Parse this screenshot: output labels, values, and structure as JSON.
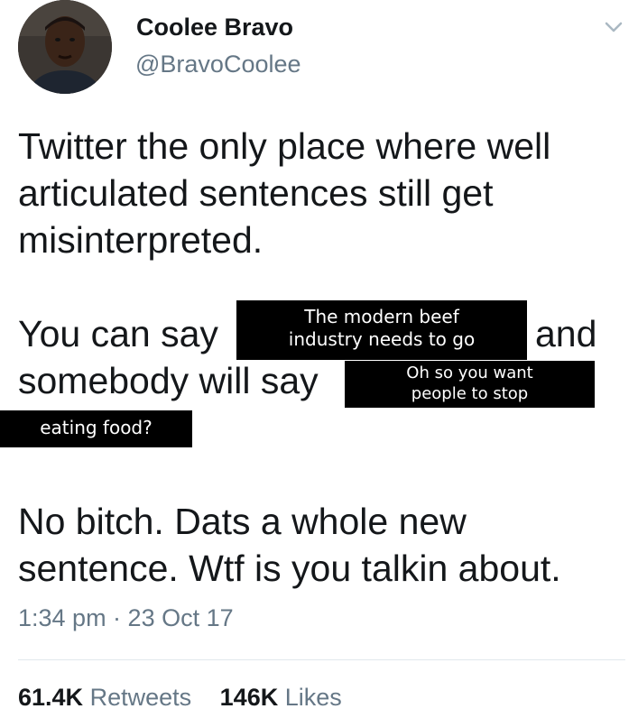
{
  "author": {
    "display_name": "Coolee Bravo",
    "handle": "@BravoCoolee",
    "avatar_icon": "profile-photo"
  },
  "tweet": {
    "paragraph1_line1": "Twitter the only place where well",
    "paragraph1_line2": "articulated sentences still get",
    "paragraph1_line3": "misinterpreted.",
    "paragraph2_you_can_say": "You can say",
    "paragraph2_and": "and",
    "paragraph2_somebody_will_say": "somebody will say",
    "paragraph3_line1": "No bitch. Dats a whole new",
    "paragraph3_line2": "sentence. Wtf is you talkin about."
  },
  "overlays": {
    "box1_line1": "The modern beef",
    "box1_line2": "industry needs to go",
    "box2_line1": "Oh so you want",
    "box2_line2": "people to stop",
    "box3": "eating food?"
  },
  "timestamp": "1:34 pm · 23 Oct 17",
  "stats": {
    "retweets_count": "61.4K",
    "retweets_label": "Retweets",
    "likes_count": "146K",
    "likes_label": "Likes"
  },
  "colors": {
    "text_primary": "#14171a",
    "text_secondary": "#657786",
    "overlay_bg": "#000000",
    "overlay_text": "#ffffff"
  }
}
